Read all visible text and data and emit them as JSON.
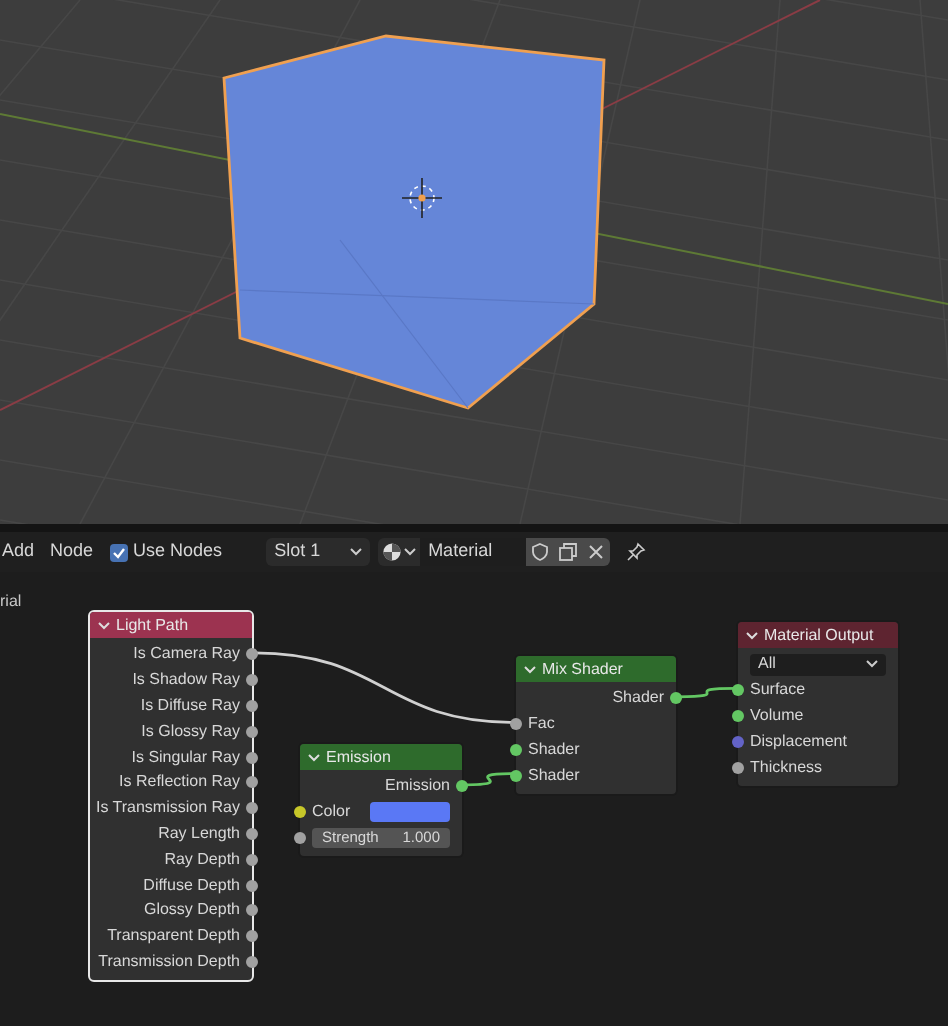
{
  "toolbar": {
    "menus": [
      "Add",
      "Node"
    ],
    "use_nodes": {
      "label": "Use Nodes",
      "checked": true
    },
    "slot": "Slot 1",
    "material_name": "Material"
  },
  "breadcrumb": "rial",
  "nodes": [
    {
      "title": "Light Path",
      "color": "#9c3350",
      "selected": true,
      "rows": [
        {
          "kind": "output",
          "label": "Is Camera Ray",
          "color": "#a1a1a1"
        },
        {
          "kind": "output",
          "label": "Is Shadow Ray",
          "color": "#a1a1a1"
        },
        {
          "kind": "output",
          "label": "Is Diffuse Ray",
          "color": "#a1a1a1"
        },
        {
          "kind": "output",
          "label": "Is Glossy Ray",
          "color": "#a1a1a1"
        },
        {
          "kind": "output",
          "label": "Is Singular Ray",
          "color": "#a1a1a1"
        },
        {
          "kind": "output",
          "label": "Is Reflection Ray",
          "color": "#a1a1a1"
        },
        {
          "kind": "output",
          "label": "Is Transmission Ray",
          "color": "#a1a1a1"
        },
        {
          "kind": "output",
          "label": "Ray Length",
          "color": "#a1a1a1"
        },
        {
          "kind": "output",
          "label": "Ray Depth",
          "color": "#a1a1a1"
        },
        {
          "kind": "output",
          "label": "Diffuse Depth",
          "color": "#a1a1a1"
        },
        {
          "kind": "output",
          "label": "Glossy Depth",
          "color": "#a1a1a1"
        },
        {
          "kind": "output",
          "label": "Transparent Depth",
          "color": "#a1a1a1"
        },
        {
          "kind": "output",
          "label": "Transmission Depth",
          "color": "#a1a1a1"
        }
      ]
    },
    {
      "title": "Emission",
      "color": "#2e6b2c",
      "selected": false,
      "rows": [
        {
          "kind": "output",
          "label": "Emission",
          "color": "#63c763"
        },
        {
          "kind": "color_input",
          "label": "Color",
          "color": "#c7c729",
          "swatch": {
            "color": "#5a78f5"
          }
        },
        {
          "kind": "value_input",
          "label": "Strength",
          "value": "1.000",
          "color": "#a1a1a1"
        }
      ]
    },
    {
      "title": "Mix Shader",
      "color": "#2e6b2c",
      "selected": false,
      "rows": [
        {
          "kind": "output",
          "label": "Shader",
          "color": "#63c763"
        },
        {
          "kind": "input",
          "label": "Fac",
          "color": "#a1a1a1"
        },
        {
          "kind": "input",
          "label": "Shader",
          "color": "#63c763"
        },
        {
          "kind": "input",
          "label": "Shader",
          "color": "#63c763"
        }
      ]
    },
    {
      "title": "Material Output",
      "color": "#5e2430",
      "selected": false,
      "rows": [
        {
          "kind": "dropdown",
          "value": "All"
        },
        {
          "kind": "input",
          "label": "Surface",
          "color": "#63c763"
        },
        {
          "kind": "input",
          "label": "Volume",
          "color": "#63c763"
        },
        {
          "kind": "input",
          "label": "Displacement",
          "color": "#6363c7"
        },
        {
          "kind": "input",
          "label": "Thickness",
          "color": "#a1a1a1"
        }
      ]
    }
  ]
}
